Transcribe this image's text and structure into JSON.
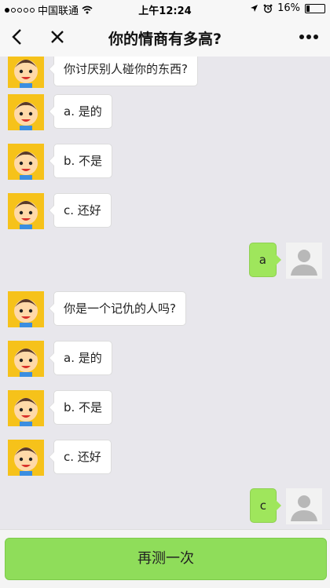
{
  "status_bar": {
    "carrier": "中国联通",
    "time": "上午12:24",
    "battery": "16%",
    "battery_level": 0.16
  },
  "nav": {
    "title": "你的情商有多高?"
  },
  "messages": [
    {
      "from": "bot",
      "text": "你讨厌别人碰你的东西?"
    },
    {
      "from": "bot",
      "text": "a. 是的"
    },
    {
      "from": "bot",
      "text": "b. 不是"
    },
    {
      "from": "bot",
      "text": "c. 还好"
    },
    {
      "from": "user",
      "text": "a"
    },
    {
      "from": "bot",
      "text": "你是一个记仇的人吗?"
    },
    {
      "from": "bot",
      "text": "a. 是的"
    },
    {
      "from": "bot",
      "text": "b. 不是"
    },
    {
      "from": "bot",
      "text": "c. 还好"
    },
    {
      "from": "user",
      "text": "c"
    }
  ],
  "bottom": {
    "retry_label": "再测一次"
  },
  "colors": {
    "user_bubble": "#9fe65c",
    "button": "#8fdd5a"
  }
}
